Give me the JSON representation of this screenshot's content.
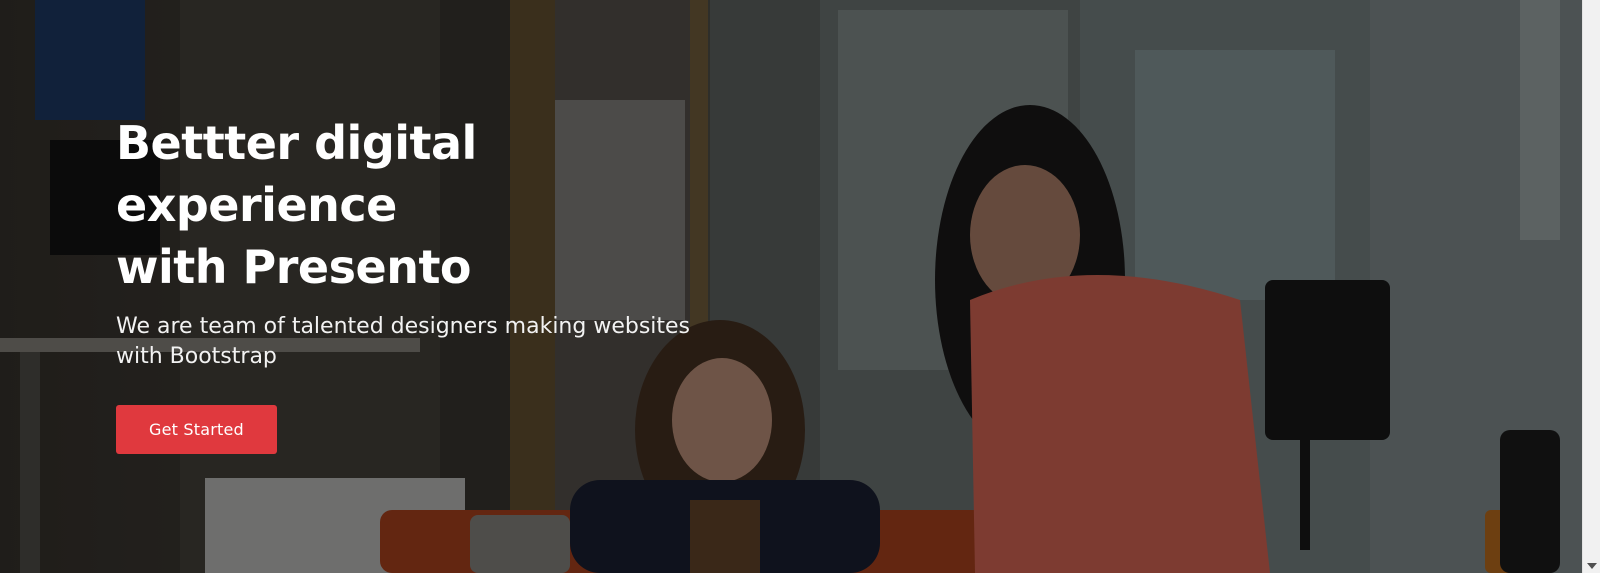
{
  "hero": {
    "title_line_1": "Bettter digital experience",
    "title_line_2": "with Presento",
    "subtitle": "We are team of talented designers making websites with Bootstrap",
    "cta_label": "Get Started"
  },
  "colors": {
    "accent": "#e0393e",
    "overlay": "rgba(0,0,0,0.45)"
  },
  "scrollbar": {
    "down_arrow_icon": "chevron-down-icon"
  }
}
